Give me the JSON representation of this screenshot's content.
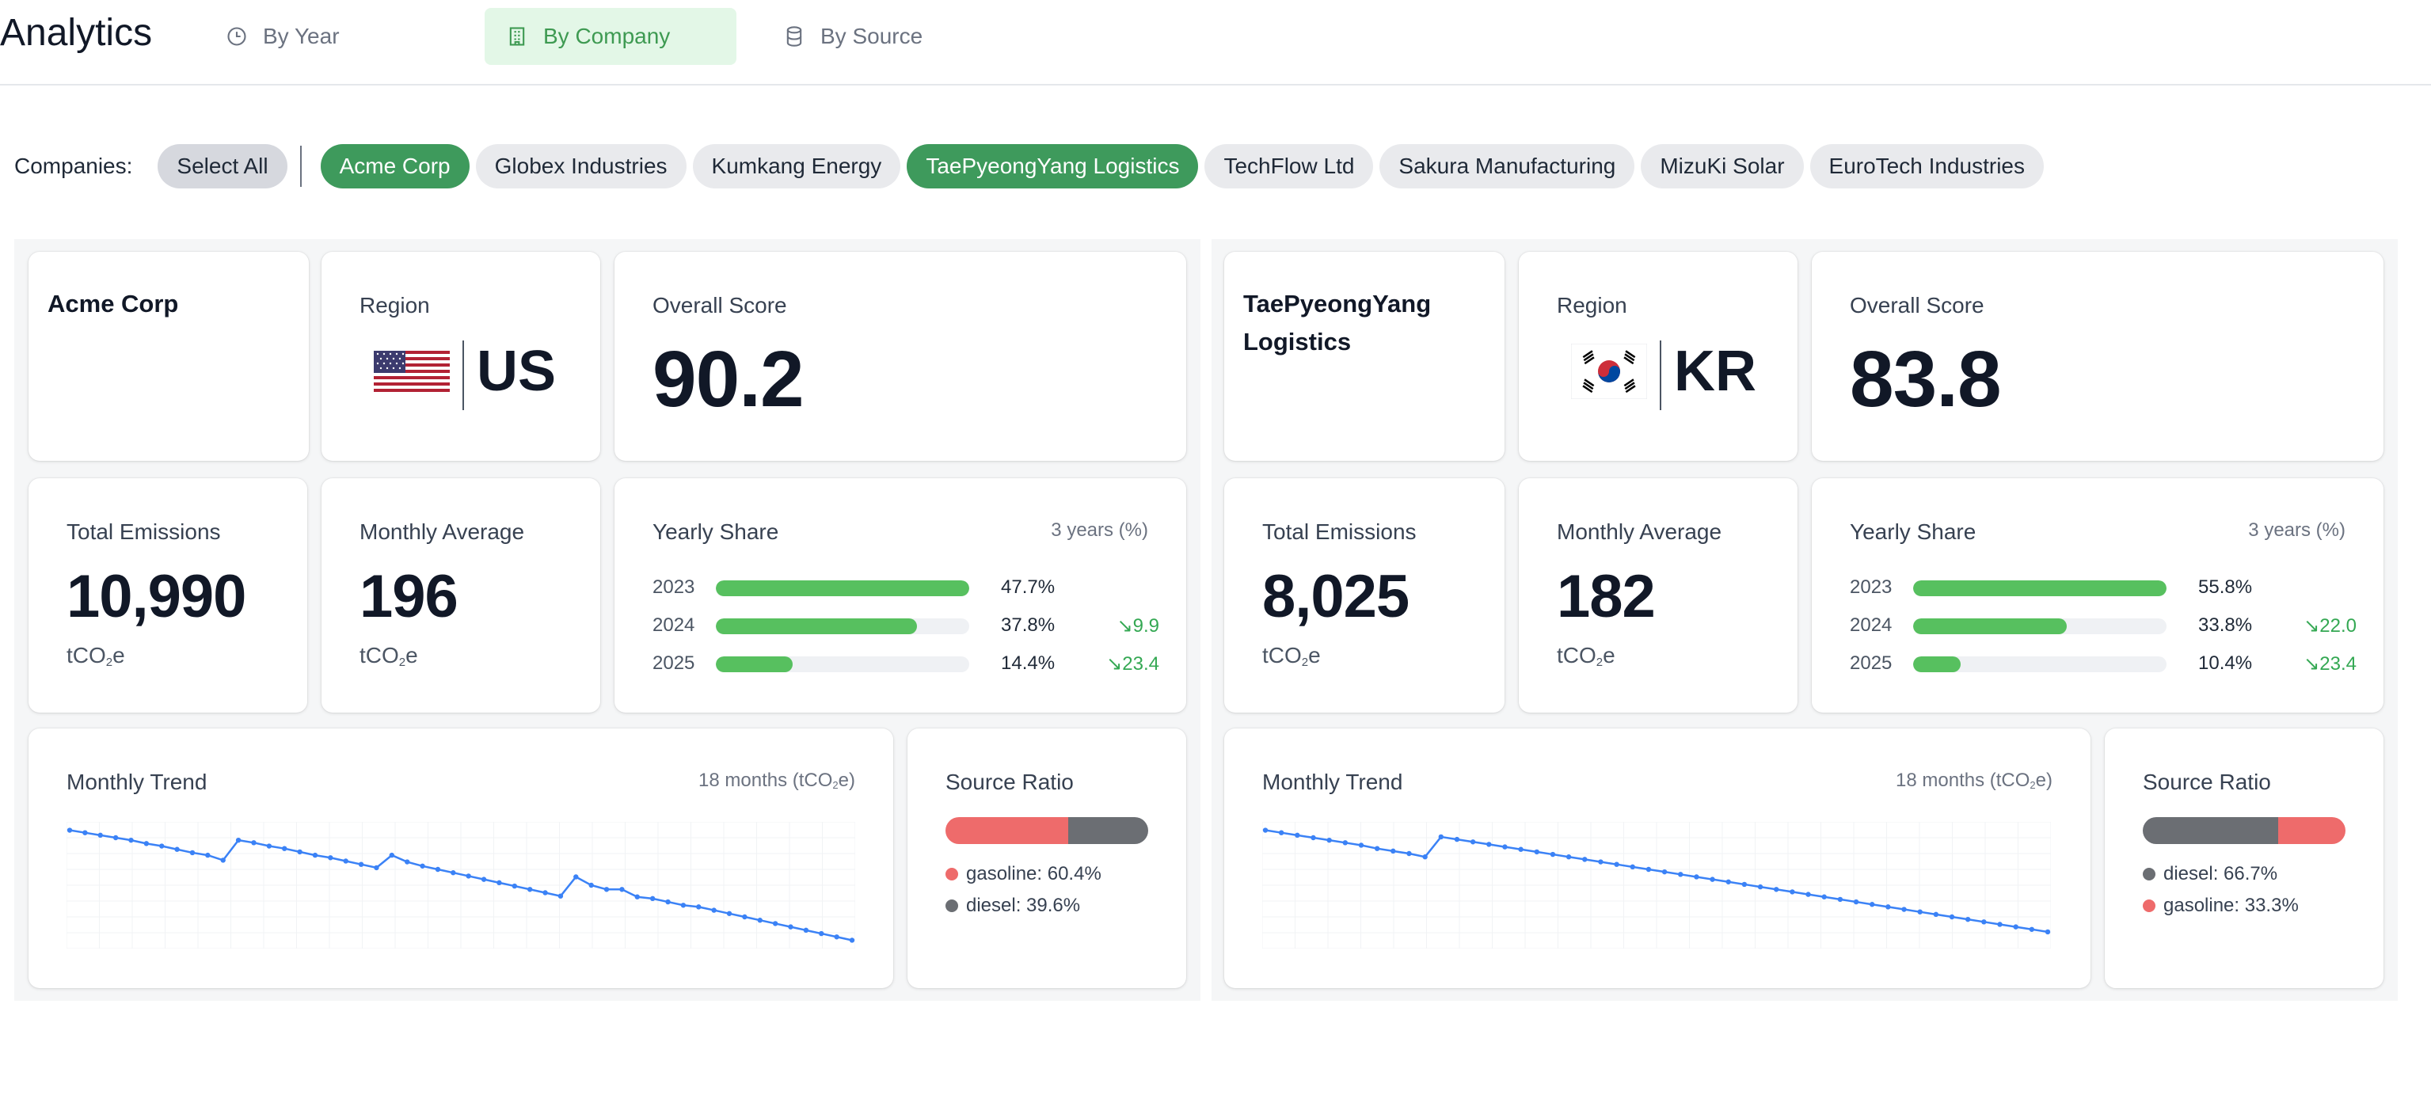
{
  "app": {
    "title": "Analytics"
  },
  "tabs": [
    {
      "label": "By Year",
      "icon": "clock-icon",
      "active": false
    },
    {
      "label": "By Company",
      "icon": "building-icon",
      "active": true
    },
    {
      "label": "By Source",
      "icon": "database-icon",
      "active": false
    }
  ],
  "filter": {
    "label": "Companies:",
    "select_all": "Select All",
    "companies": [
      {
        "name": "Acme Corp",
        "selected": true
      },
      {
        "name": "Globex Industries",
        "selected": false
      },
      {
        "name": "Kumkang Energy",
        "selected": false
      },
      {
        "name": "TaePyeongYang Logistics",
        "selected": true
      },
      {
        "name": "TechFlow Ltd",
        "selected": false
      },
      {
        "name": "Sakura Manufacturing",
        "selected": false
      },
      {
        "name": "MizuKi Solar",
        "selected": false
      },
      {
        "name": "EuroTech Industries",
        "selected": false
      }
    ]
  },
  "labels": {
    "region": "Region",
    "overall_score": "Overall Score",
    "total_emissions": "Total Emissions",
    "monthly_average": "Monthly Average",
    "yearly_share": "Yearly Share",
    "yearly_share_note": "3 years (%)",
    "monthly_trend": "Monthly Trend",
    "monthly_trend_note_pre": "18 months (tCO",
    "monthly_trend_note_sub": "2",
    "monthly_trend_note_post": "e)",
    "source_ratio": "Source Ratio",
    "unit_pre": "tCO",
    "unit_sub": "2",
    "unit_post": "e"
  },
  "colors": {
    "accent_green": "#3e9a5c",
    "share_bar": "#57c05f",
    "trend_line": "#3b82f6",
    "gasoline": "#ee6b6b",
    "diesel": "#6b6e73",
    "delta_down": "#34a853"
  },
  "companies": [
    {
      "name": "Acme Corp",
      "region": "US",
      "flag_icon": "us-flag-icon",
      "overall_score": "90.2",
      "total_emissions": "10,990",
      "monthly_average": "196",
      "yearly_share": [
        {
          "year": "2023",
          "pct_label": "47.7%",
          "value": 47.7,
          "delta": ""
        },
        {
          "year": "2024",
          "pct_label": "37.8%",
          "value": 37.8,
          "delta": "↘9.9"
        },
        {
          "year": "2025",
          "pct_label": "14.4%",
          "value": 14.4,
          "delta": "↘23.4"
        }
      ],
      "trend": [
        612,
        609,
        606,
        603,
        600,
        596,
        593,
        589,
        585,
        582,
        576,
        600,
        597,
        593,
        590,
        586,
        582,
        579,
        575,
        571,
        567,
        582,
        574,
        569,
        565,
        561,
        557,
        553,
        549,
        545,
        541,
        537,
        533,
        556,
        546,
        541,
        541,
        532,
        530,
        526,
        522,
        520,
        516,
        512,
        508,
        504,
        500,
        496,
        492,
        488,
        484,
        480
      ],
      "source_ratio": [
        {
          "source": "gasoline",
          "label": "gasoline: 60.4%",
          "value": 60.4
        },
        {
          "source": "diesel",
          "label": "diesel: 39.6%",
          "value": 39.6
        }
      ]
    },
    {
      "name": "TaePyeongYang Logistics",
      "region": "KR",
      "flag_icon": "kr-flag-icon",
      "overall_score": "83.8",
      "total_emissions": "8,025",
      "monthly_average": "182",
      "yearly_share": [
        {
          "year": "2023",
          "pct_label": "55.8%",
          "value": 55.8,
          "delta": ""
        },
        {
          "year": "2024",
          "pct_label": "33.8%",
          "value": 33.8,
          "delta": "↘22.0"
        },
        {
          "year": "2025",
          "pct_label": "10.4%",
          "value": 10.4,
          "delta": "↘23.4"
        }
      ],
      "trend": [
        612,
        609,
        606,
        603,
        600,
        597,
        594,
        590,
        587,
        584,
        580,
        604,
        601,
        598,
        595,
        592,
        589,
        586,
        583,
        580,
        577,
        574,
        571,
        568,
        565,
        562,
        559,
        556,
        553,
        550,
        547,
        544,
        541,
        538,
        535,
        532,
        529,
        526,
        523,
        520,
        517,
        514,
        511,
        508,
        505,
        502,
        499,
        496,
        493,
        490
      ],
      "source_ratio": [
        {
          "source": "diesel",
          "label": "diesel: 66.7%",
          "value": 66.7
        },
        {
          "source": "gasoline",
          "label": "gasoline: 33.3%",
          "value": 33.3
        }
      ]
    }
  ]
}
